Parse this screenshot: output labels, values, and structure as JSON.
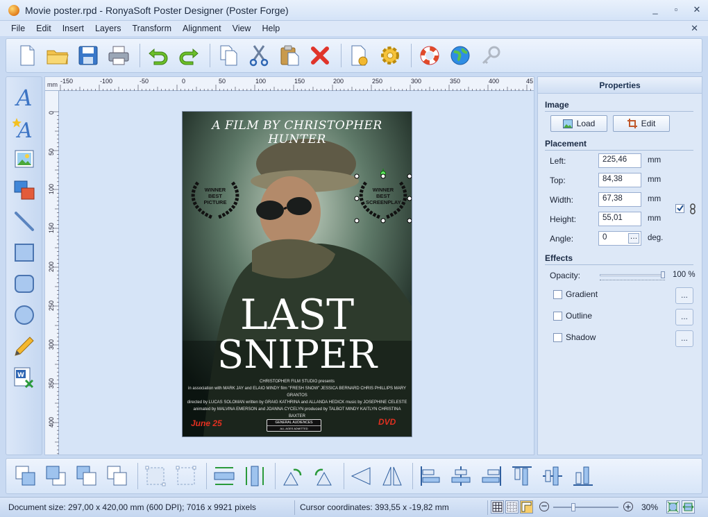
{
  "window": {
    "title": "Movie poster.rpd - RonyaSoft Poster Designer (Poster Forge)",
    "controls": [
      "_",
      "▫",
      "✕"
    ]
  },
  "menu": {
    "items": [
      "File",
      "Edit",
      "Insert",
      "Layers",
      "Transform",
      "Alignment",
      "View",
      "Help"
    ],
    "close": "✕"
  },
  "toolbar": {
    "buttons": [
      "new-document",
      "open-folder",
      "save",
      "print",
      "undo",
      "redo",
      "copy",
      "cut",
      "paste",
      "delete",
      "page-setup",
      "settings",
      "help",
      "web",
      "key"
    ]
  },
  "left_tools": [
    "text",
    "art-text",
    "image",
    "clipart",
    "line",
    "rectangle",
    "rounded-rectangle",
    "ellipse",
    "pencil",
    "import-document"
  ],
  "ruler": {
    "unit": "mm",
    "top_labels": [
      "-150",
      "-100",
      "-50",
      "0",
      "50",
      "100",
      "150",
      "200",
      "250",
      "300",
      "350",
      "400",
      "45"
    ],
    "left_labels": [
      "0",
      "50",
      "100",
      "150",
      "200",
      "250",
      "300",
      "350",
      "400"
    ]
  },
  "poster": {
    "tagline": "A FILM BY CHRISTOPHER HUNTER",
    "laurel_left": [
      "WINNER",
      "BEST",
      "PICTURE"
    ],
    "laurel_right": [
      "WINNER",
      "BEST",
      "SCREENPLAY"
    ],
    "title_line1": "LAST",
    "title_line2": "SNIPER",
    "credits": [
      "CHRISTOPHER FILM STUDIO presents",
      "in association with MARK JAY and ELAIO MINDY film \"FRESH SNOW\" JESSICA BERNARD CHRIS PHILLIPS MARY GRANTOS",
      "directed by LUCAS SOLOMAN written by GRAIG KATHRINA and ALLANDA HEDICK music by JOSEPHINE CELESTE",
      "animated by MALVINA EMERSON and JOANNA CYCELYN produced by TALBOT MINDY KAITLYN CHRISTINA BAXTER"
    ],
    "release_date": "June 25",
    "rating_top": "GENERAL AUDIENCES",
    "rating_bottom": "ALL AGES ADMITTED",
    "dvd": "DVD"
  },
  "properties": {
    "header": "Properties",
    "image_section": "Image",
    "load_label": "Load",
    "edit_label": "Edit",
    "placement_section": "Placement",
    "left_label": "Left:",
    "left_value": "225,46",
    "top_label": "Top:",
    "top_value": "84,38",
    "width_label": "Width:",
    "width_value": "67,38",
    "height_label": "Height:",
    "height_value": "55,01",
    "angle_label": "Angle:",
    "angle_value": "0",
    "unit_mm": "mm",
    "unit_deg": "deg.",
    "aspect_locked": true,
    "effects_section": "Effects",
    "opacity_label": "Opacity:",
    "opacity_value": "100 %",
    "opacity_level": 1.0,
    "gradient_label": "Gradient",
    "outline_label": "Outline",
    "shadow_label": "Shadow",
    "dots": "..."
  },
  "bottom_toolbar": {
    "buttons": [
      "bring-to-front",
      "send-to-back",
      "bring-forward",
      "send-backward",
      "group",
      "ungroup",
      "fit-width",
      "fit-height",
      "rotate-left",
      "rotate-right",
      "flip-horizontal",
      "flip-vertical",
      "align-left",
      "align-center",
      "align-right",
      "align-top",
      "align-middle",
      "align-bottom"
    ]
  },
  "status": {
    "document_size": "Document size: 297,00 x 420,00 mm (600 DPI); 7016 x 9921 pixels",
    "cursor": "Cursor coordinates: 393,55 x -19,82 mm",
    "zoom_minus": "−",
    "zoom_plus": "+",
    "zoom_value": "30%"
  }
}
